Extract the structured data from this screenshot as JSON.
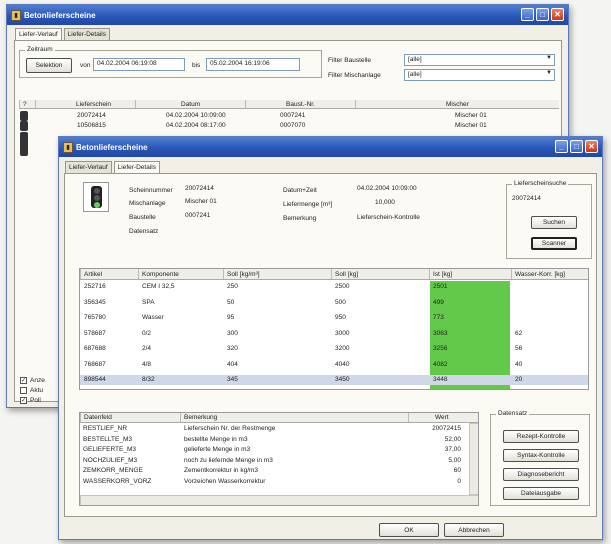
{
  "back_window": {
    "title": "Betonlieferscheine",
    "tabs": [
      "Liefer-Verlauf",
      "Liefer-Details"
    ],
    "zeitraum": {
      "label": "Zeitraum",
      "selektion": "Selektion",
      "von_label": "von",
      "von": "04.02.2004 06:19:08",
      "bis_label": "bis",
      "bis": "05.02.2004 16:19:06"
    },
    "filter_baustelle": {
      "label": "Filter Baustelle",
      "value": "[alle]"
    },
    "filter_mischanlage": {
      "label": "Filter Mischanlage",
      "value": "[alle]"
    },
    "columns": [
      "?",
      "Lieferschein",
      "Datum",
      "Baust.-Nr.",
      "Mischer"
    ],
    "rows": [
      {
        "lieferschein": "20072414",
        "datum": "04.02.2004 10:09:00",
        "baust": "0007241",
        "mischer": "Mischer 01"
      },
      {
        "lieferschein": "10506815",
        "datum": "04.02.2004 08:17:00",
        "baust": "0007070",
        "mischer": "Mischer 01"
      }
    ],
    "checks": [
      {
        "label": "Anze",
        "checked": true
      },
      {
        "label": "Aktu",
        "checked": false
      },
      {
        "label": "Poll",
        "checked": true
      }
    ]
  },
  "front_window": {
    "title": "Betonlieferscheine",
    "tabs": [
      "Liefer-Verlauf",
      "Liefer-Details"
    ],
    "details": {
      "scheinnummer_label": "Scheinnummer",
      "scheinnummer": "20072414",
      "mischanlage_label": "Mischanlage",
      "mischanlage": "Mischer 01",
      "baustelle_label": "Baustelle",
      "baustelle": "0007241",
      "datensatz_label": "Datensatz",
      "datum_label": "Datum+Zeit",
      "datum": "04.02.2004 10:09:00",
      "liefermenge_label": "Liefermenge [m³]",
      "liefermenge": "10,000",
      "bemerkung_label": "Bemerkung",
      "bemerkung": "Lieferschein-Kontrolle"
    },
    "suche": {
      "label": "Lieferscheinsuche",
      "value": "20072414",
      "suchen": "Suchen",
      "scanner": "Scanner"
    },
    "table": {
      "columns": [
        "Artikel",
        "Komponente",
        "Soll [kg/m³]",
        "Soll [kg]",
        "Ist [kg]",
        "Wasser-Korr. [kg]"
      ],
      "rows": [
        {
          "artikel": "252716",
          "komponente": "CEM I 32,5",
          "soll_m3": "250",
          "soll": "2500",
          "ist": "2501",
          "wasser": ""
        },
        {
          "artikel": "356345",
          "komponente": "SPA",
          "soll_m3": "50",
          "soll": "500",
          "ist": "499",
          "wasser": ""
        },
        {
          "artikel": "765780",
          "komponente": "Wasser",
          "soll_m3": "95",
          "soll": "950",
          "ist": "773",
          "wasser": ""
        },
        {
          "artikel": "578687",
          "komponente": "0/2",
          "soll_m3": "300",
          "soll": "3000",
          "ist": "3063",
          "wasser": "62"
        },
        {
          "artikel": "687688",
          "komponente": "2/4",
          "soll_m3": "320",
          "soll": "3200",
          "ist": "3256",
          "wasser": "56"
        },
        {
          "artikel": "768687",
          "komponente": "4/8",
          "soll_m3": "404",
          "soll": "4040",
          "ist": "4082",
          "wasser": "40"
        },
        {
          "artikel": "898544",
          "komponente": "8/32",
          "soll_m3": "345",
          "soll": "3450",
          "ist": "3448",
          "wasser": "20"
        }
      ]
    },
    "datenfeld_table": {
      "columns": [
        "Datenfeld",
        "Bemerkung",
        "Wert"
      ],
      "rows": [
        {
          "feld": "RESTLIEF_NR",
          "bem": "Lieferschein Nr. der Restmenge",
          "wert": "20072415"
        },
        {
          "feld": "BESTELLTE_M3",
          "bem": "bestellte Menge in m3",
          "wert": "52,00"
        },
        {
          "feld": "GELIEFERTE_M3",
          "bem": "gelieferte Menge in m3",
          "wert": "37,00"
        },
        {
          "feld": "NOCHZULIEF_M3",
          "bem": "noch zu liefernde Menge in m3",
          "wert": "5,00"
        },
        {
          "feld": "ZEMKORR_MENGE",
          "bem": "Zementkorrektur in kg/m3",
          "wert": "60"
        },
        {
          "feld": "WASSERKORR_VORZ",
          "bem": "Vorzeichen Wasserkorrektur",
          "wert": "0"
        }
      ]
    },
    "datensatz": {
      "label": "Datensatz",
      "buttons": [
        "Rezept-Kontrolle",
        "Syntax-Kontrolle",
        "Diagnosebericht",
        "Dateiausgabe"
      ]
    },
    "ok": "OK",
    "abbrechen": "Abbrechen"
  },
  "colors": {
    "title_bar": "#2b57b7",
    "ist_highlight": "#63c94a",
    "selection": "#316ac5"
  }
}
